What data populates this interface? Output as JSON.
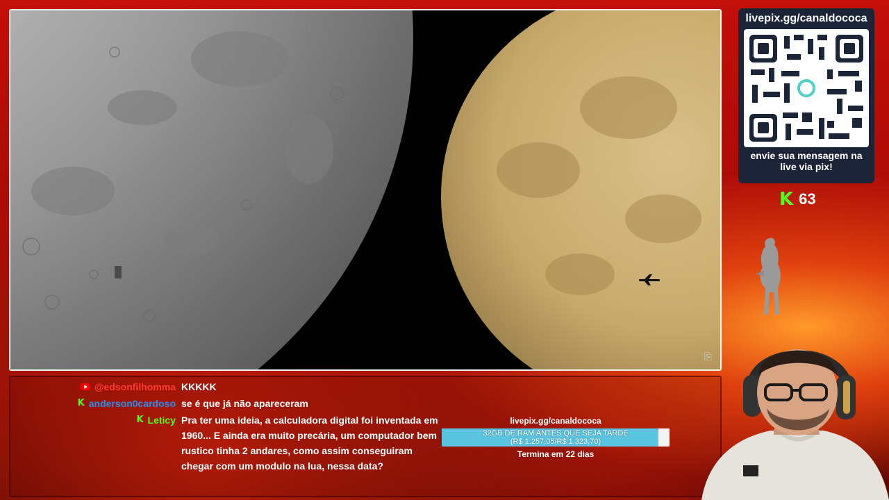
{
  "qr_card": {
    "title": "livepix.gg/canaldococa",
    "caption": "envie sua mensagem na live via pix!"
  },
  "counter": {
    "icon": "kick-icon",
    "value": "63"
  },
  "chat": {
    "messages": [
      {
        "platform": "youtube",
        "username": "@edsonfilhomma",
        "username_color": "#ff3b30",
        "text": "KKKKK"
      },
      {
        "platform": "kick",
        "username": "anderson0cardoso",
        "username_color": "#2d8cf0",
        "text": "se é que já não apareceram"
      },
      {
        "platform": "kick",
        "username": "Leticy",
        "username_color": "#53fc18",
        "text": "Pra ter uma ideia, a calculadora digital foi inventada em 1960... E ainda era muito precária, um computador bem rustico tinha 2 andares, como assim conseguiram chegar com um modulo na lua, nessa data?"
      }
    ]
  },
  "goal": {
    "title": "livepix.gg/canaldococa",
    "goal_name": "32GB DE RAM ANTES QUE SEJA TARDE",
    "amount": "(R$ 1.257,05/R$ 1.323,70)",
    "progress": 0.95,
    "footer": "Termina em 22 dias",
    "bar_color": "#5bc4e0"
  },
  "colors": {
    "kick_green": "#53fc18",
    "youtube_red": "#ff0000",
    "qr_card_bg": "#1c2438"
  }
}
